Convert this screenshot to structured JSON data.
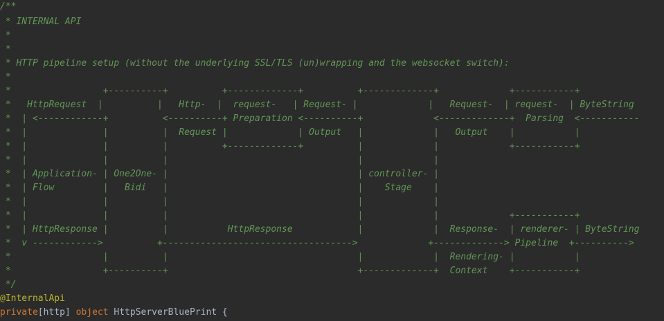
{
  "editor": {
    "comment_lines": [
      "/**",
      " * INTERNAL API",
      " *",
      " *",
      " * HTTP pipeline setup (without the underlying SSL/TLS (un)wrapping and the websocket switch):",
      " *",
      " *                 +----------+          +-------------+          +-------------+             +-----------+",
      " *   HttpRequest  |          |   Http-  |  request-   | Request- |             |   Request-  | request-  | ByteString",
      " *  | <------------+          <----------+ Preparation <----------+             <-------------+  Parsing  <-----------",
      " *  |              |          |  Request |             | Output   |             |   Output    |           |",
      " *  |              |          |          +-------------+          |             |             +-----------+",
      " *  |              |          |                                   |             |",
      " *  | Application- | One2One- |                                   | controller- |",
      " *  | Flow         |   Bidi   |                                   |    Stage    |",
      " *  |              |          |                                   |             |",
      " *  |              |          |                                   |             |             +-----------+",
      " *  | HttpResponse |          |           HttpResponse            |             |  Response-  | renderer- | ByteString",
      " *  v ------------>          +----------------------------------->             +-------------> Pipeline  +---------->",
      " *                 |          |                                   |             |  Rendering- |           |",
      " *                 +----------+                                   +-------------+  Context    +-----------+",
      " */"
    ],
    "annotation": "@InternalApi",
    "code": {
      "modifier": "private",
      "scope_open": "[",
      "scope": "http",
      "scope_close": "]",
      "keyword": "object",
      "declaration": " HttpServerBluePrint {"
    }
  }
}
